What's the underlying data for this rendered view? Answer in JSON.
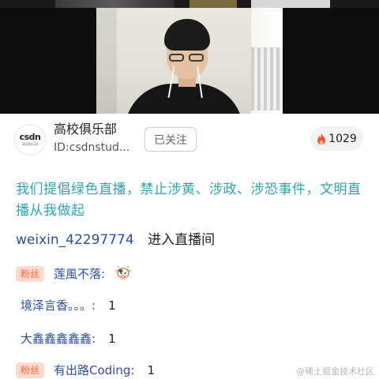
{
  "host": {
    "avatar_brand": "csdn",
    "avatar_sub": "高校俱乐部",
    "name": "高校俱乐部",
    "id": "ID:csdnstud...",
    "follow_label": "已关注",
    "hot_count": "1029"
  },
  "chat": {
    "notice": "我们提倡绿色直播，禁止涉黄、涉政、涉恐事件，文明直播从我做起",
    "enter_user": "weixin_42297774",
    "enter_text": "进入直播间",
    "messages": [
      {
        "badge": "粉丝",
        "name": "莲風不落:",
        "text": "",
        "emoji": "cow-icon"
      },
      {
        "badge": "",
        "name": "境泽言香。。。:",
        "text": "1"
      },
      {
        "badge": "",
        "name": "大鑫鑫鑫鑫鑫:",
        "text": "1"
      },
      {
        "badge": "粉丝",
        "name": "有出路Coding:",
        "text": "1"
      }
    ]
  },
  "watermark": "@稀土掘金技术社区",
  "colors": {
    "notice": "#2aa6b0",
    "username": "#2b4fa2",
    "fan_badge_bg": "#ffd9cc",
    "fan_badge_text": "#ff6a3d",
    "hot_flame": "#ff4d2e"
  }
}
